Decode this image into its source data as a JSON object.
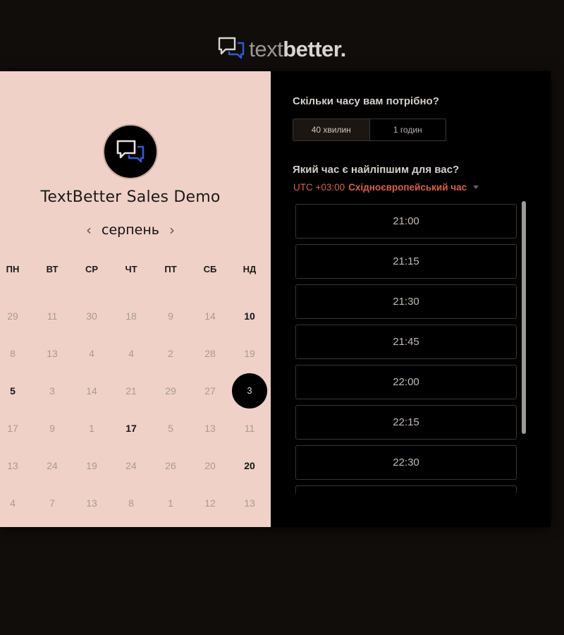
{
  "logo": {
    "text_light": "text",
    "text_bold": "better",
    "dot": "."
  },
  "event": {
    "title": "TextBetter Sales Demo",
    "avatar_icon": "chat-bubbles-icon"
  },
  "calendar": {
    "month": "серпень",
    "prev_icon": "chevron-left-icon",
    "next_icon": "chevron-right-icon",
    "weekdays": [
      "ПН",
      "ВТ",
      "СР",
      "ЧТ",
      "ПТ",
      "СБ",
      "НД"
    ],
    "days": [
      {
        "label": "29",
        "state": "unavailable"
      },
      {
        "label": "11",
        "state": "unavailable"
      },
      {
        "label": "30",
        "state": "unavailable"
      },
      {
        "label": "18",
        "state": "unavailable"
      },
      {
        "label": "9",
        "state": "unavailable"
      },
      {
        "label": "14",
        "state": "unavailable"
      },
      {
        "label": "10",
        "state": "available"
      },
      {
        "label": "8",
        "state": "unavailable"
      },
      {
        "label": "13",
        "state": "unavailable"
      },
      {
        "label": "4",
        "state": "unavailable"
      },
      {
        "label": "4",
        "state": "unavailable"
      },
      {
        "label": "2",
        "state": "unavailable"
      },
      {
        "label": "28",
        "state": "unavailable"
      },
      {
        "label": "19",
        "state": "unavailable"
      },
      {
        "label": "5",
        "state": "available"
      },
      {
        "label": "3",
        "state": "unavailable"
      },
      {
        "label": "14",
        "state": "unavailable"
      },
      {
        "label": "21",
        "state": "unavailable"
      },
      {
        "label": "29",
        "state": "unavailable"
      },
      {
        "label": "27",
        "state": "unavailable"
      },
      {
        "label": "3",
        "state": "selected"
      },
      {
        "label": "17",
        "state": "unavailable"
      },
      {
        "label": "9",
        "state": "unavailable"
      },
      {
        "label": "1",
        "state": "unavailable"
      },
      {
        "label": "17",
        "state": "available"
      },
      {
        "label": "5",
        "state": "unavailable"
      },
      {
        "label": "13",
        "state": "unavailable"
      },
      {
        "label": "11",
        "state": "unavailable"
      },
      {
        "label": "13",
        "state": "unavailable"
      },
      {
        "label": "24",
        "state": "unavailable"
      },
      {
        "label": "19",
        "state": "unavailable"
      },
      {
        "label": "24",
        "state": "unavailable"
      },
      {
        "label": "26",
        "state": "unavailable"
      },
      {
        "label": "20",
        "state": "unavailable"
      },
      {
        "label": "20",
        "state": "available"
      },
      {
        "label": "4",
        "state": "unavailable"
      },
      {
        "label": "7",
        "state": "unavailable"
      },
      {
        "label": "13",
        "state": "unavailable"
      },
      {
        "label": "8",
        "state": "unavailable"
      },
      {
        "label": "1",
        "state": "unavailable"
      },
      {
        "label": "12",
        "state": "unavailable"
      },
      {
        "label": "13",
        "state": "unavailable"
      }
    ]
  },
  "booking": {
    "duration_question": "Скільки часу вам потрібно?",
    "durations": [
      {
        "label": "40 хвилин",
        "active": true
      },
      {
        "label": "1 годин",
        "active": false
      }
    ],
    "time_question": "Який час є найліпшим для вас?",
    "timezone_offset": "UTC +03:00",
    "timezone_name": "Східноєвропейський час",
    "timezone_caret_icon": "caret-down-icon",
    "slots": [
      "21:00",
      "21:15",
      "21:30",
      "21:45",
      "22:00",
      "22:15",
      "22:30",
      ""
    ]
  },
  "colors": {
    "left_panel_bg": "#f0d1c7",
    "accent": "#d9604a",
    "page_bg": "#110d0a"
  }
}
